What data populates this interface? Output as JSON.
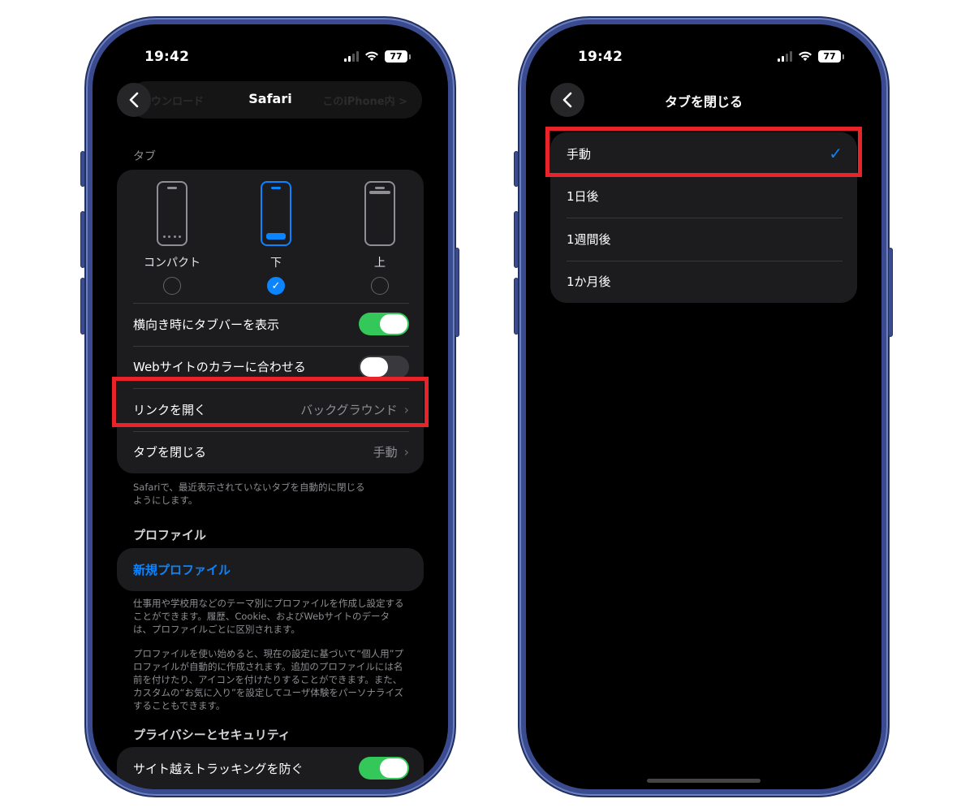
{
  "left_screen": {
    "status": {
      "time": "19:42",
      "battery": "77"
    },
    "nav": {
      "title": "Safari",
      "ghost_left": "ウンロード",
      "ghost_right": "このiPhone内 >"
    },
    "tabs_section": {
      "header": "タブ",
      "layouts": [
        {
          "label": "コンパクト",
          "selected": false
        },
        {
          "label": "下",
          "selected": true
        },
        {
          "label": "上",
          "selected": false
        }
      ],
      "rows": {
        "landscape_tabbar": {
          "label": "横向き時にタブバーを表示",
          "toggle": true
        },
        "website_color": {
          "label": "Webサイトのカラーに合わせる",
          "toggle": false
        },
        "open_links": {
          "label": "リンクを開く",
          "value": "バックグラウンド"
        },
        "close_tabs": {
          "label": "タブを閉じる",
          "value": "手動"
        }
      },
      "footnote": "Safariで、最近表示されていないタブを自動的に閉じる\nようにします。"
    },
    "profiles_section": {
      "header": "プロファイル",
      "new_profile": "新規プロファイル",
      "footnote1": "仕事用や学校用などのテーマ別にプロファイルを作成し設定することができます。履歴、Cookie、およびWebサイトのデータは、プロファイルごとに区別されます。",
      "footnote2": "プロファイルを使い始めると、現在の設定に基づいて“個人用”プロファイルが自動的に作成されます。追加のプロファイルには名前を付けたり、アイコンを付けたりすることができます。また、カスタムの“お気に入り”を設定してユーザ体験をパーソナライズすることもできます。"
    },
    "privacy_section": {
      "header": "プライバシーとセキュリティ",
      "cross_site": {
        "label": "サイト越えトラッキングを防ぐ",
        "toggle": true
      }
    }
  },
  "right_screen": {
    "status": {
      "time": "19:42",
      "battery": "77"
    },
    "nav": {
      "title": "タブを閉じる"
    },
    "options": [
      {
        "label": "手動",
        "checked": true
      },
      {
        "label": "1日後",
        "checked": false
      },
      {
        "label": "1週間後",
        "checked": false
      },
      {
        "label": "1か月後",
        "checked": false
      }
    ]
  },
  "colors": {
    "accent_blue": "#0a84ff",
    "toggle_green": "#34c759",
    "highlight_red": "#e8232a",
    "frame_blue": "#3a4b8f"
  },
  "icons": {
    "back": "chevron-left-icon",
    "chevron": "chevron-right-icon",
    "check": "checkmark-icon",
    "wifi": "wifi-icon",
    "signal": "cellular-signal-icon",
    "battery": "battery-icon"
  }
}
